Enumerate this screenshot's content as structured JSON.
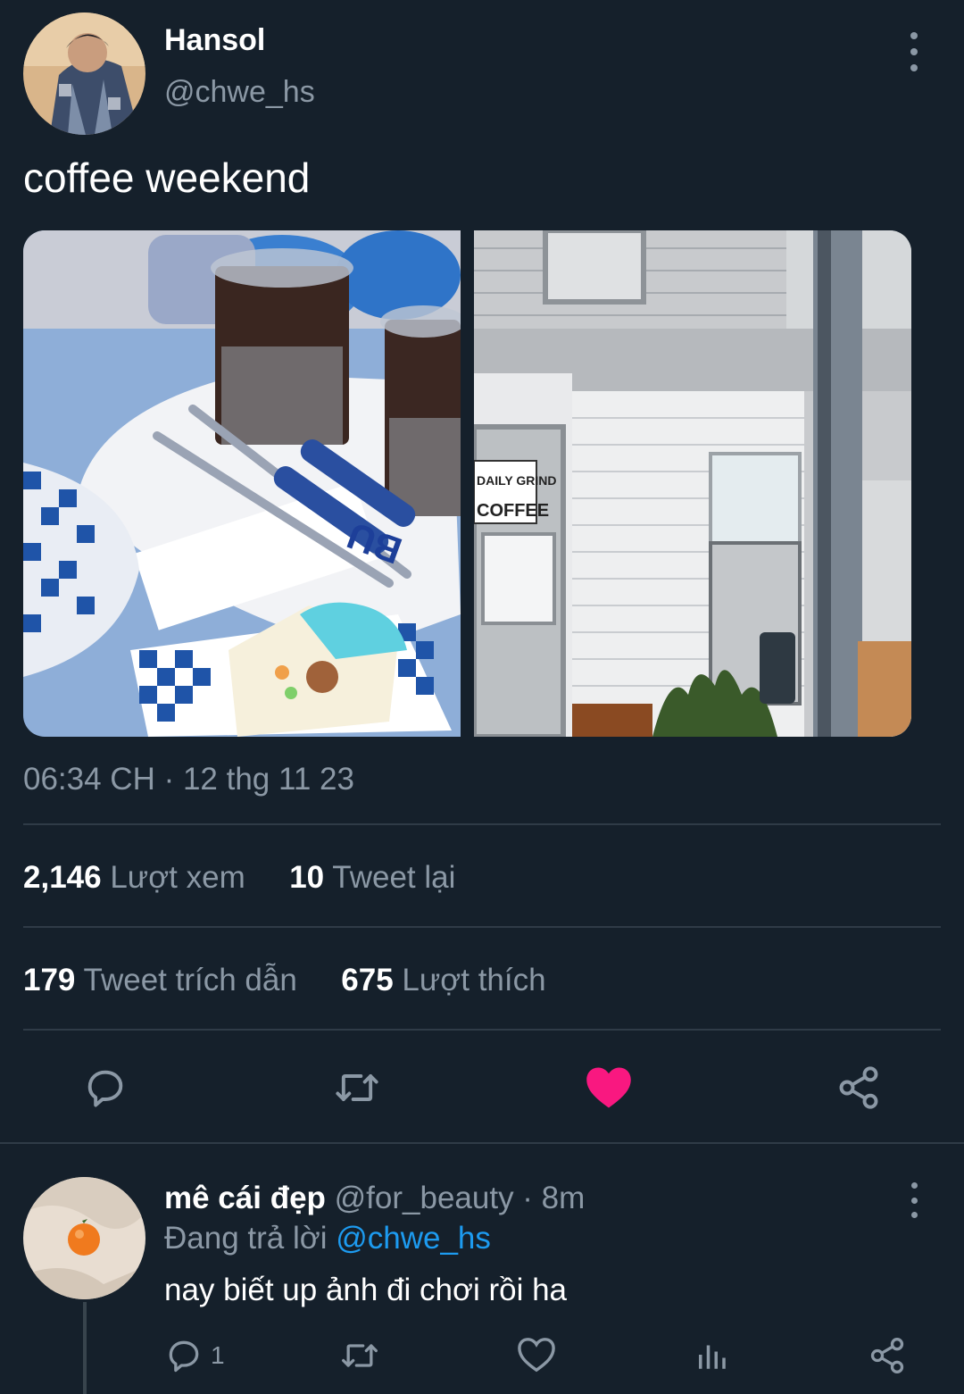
{
  "tweet": {
    "author": {
      "display_name": "Hansol",
      "handle": "@chwe_hs"
    },
    "text": "coffee weekend",
    "photos": [
      {
        "alt_icon": "coffee-table-photo"
      },
      {
        "alt_icon": "cafe-storefront-photo",
        "sign_line1": "DAILY GRIND",
        "sign_line2": "COFFEE"
      }
    ],
    "timestamp": "06:34 CH · 12 thg 11 23",
    "stats": {
      "views_count": "2,146",
      "views_label": "Lượt xem",
      "retweets_count": "10",
      "retweets_label": "Tweet lại",
      "quotes_count": "179",
      "quotes_label": "Tweet trích dẫn",
      "likes_count": "675",
      "likes_label": "Lượt thích"
    },
    "actions": [
      {
        "icon": "reply-icon"
      },
      {
        "icon": "retweet-icon"
      },
      {
        "icon": "heart-filled-icon",
        "color": "#f91880"
      },
      {
        "icon": "share-icon"
      }
    ]
  },
  "reply": {
    "display_name": "mê cái đẹp",
    "meta": "@for_beauty · 8m",
    "replying_prefix": "Đang trả lời",
    "replying_mention": "@chwe_hs",
    "text": "nay biết up ảnh đi chơi rồi ha",
    "reply_count": "1",
    "actions": [
      "reply-icon",
      "retweet-icon",
      "heart-icon",
      "analytics-icon",
      "share-icon"
    ]
  },
  "colors": {
    "background": "#15202b",
    "muted": "#8b98a5",
    "accent": "#1d9bf0",
    "like": "#f91880"
  }
}
